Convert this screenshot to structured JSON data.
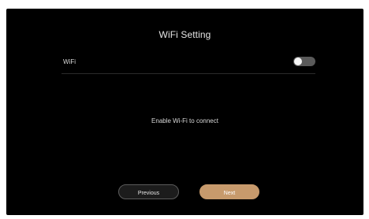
{
  "title": "WiFi Setting",
  "wifi": {
    "label": "WiFi",
    "enabled": false
  },
  "message": "Enable Wi-Fi to connect",
  "buttons": {
    "previous": "Previous",
    "next": "Next"
  },
  "colors": {
    "background": "#000000",
    "accent": "#c79a6c",
    "toggle_off": "#5a5a5a"
  }
}
